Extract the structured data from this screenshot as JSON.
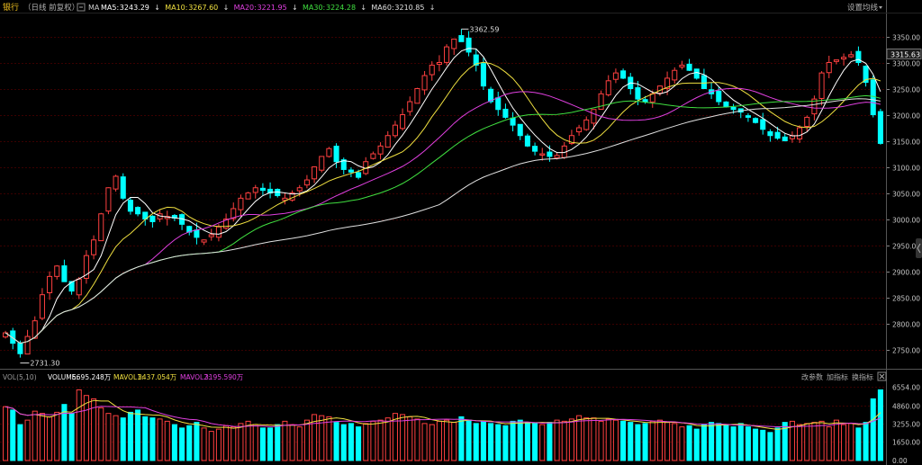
{
  "header": {
    "title": "银行",
    "period": "（日线 前复权）",
    "collapse_icon": "collapse-icon",
    "ma_prefix": "MA",
    "ma_items": [
      {
        "label": "MA5:",
        "value": "3243.29",
        "color": "#ffffff"
      },
      {
        "label": "MA10:",
        "value": "3267.60",
        "color": "#f0e040"
      },
      {
        "label": "MA20:",
        "value": "3221.95",
        "color": "#e040e0"
      },
      {
        "label": "MA30:",
        "value": "3224.28",
        "color": "#40e040"
      },
      {
        "label": "MA60:",
        "value": "3210.85",
        "color": "#e0e0e0"
      }
    ],
    "down_arrow": "↓",
    "settings_label": "设置均线",
    "settings_icon": "dropdown-icon"
  },
  "annotations": {
    "high": "3362.59",
    "low": "2731.30",
    "last_price": "3315.63"
  },
  "volume_header": {
    "title": "VOL(5,10)",
    "volume_label": "VOLUME:",
    "volume_value": "5695.248万",
    "mavol1_label": "MAVOL1:",
    "mavol1_value": "3437.054万",
    "mavol2_label": "MAVOL2:",
    "mavol2_value": "3195.590万",
    "buttons": [
      "改参数",
      "加指标",
      "换指标"
    ],
    "close_icon": "close-icon"
  },
  "colors": {
    "up": "#ff4040",
    "down": "#00ffff",
    "grid": "#3a0000",
    "axis_text": "#c8c8c8",
    "ma5": "#ffffff",
    "ma10": "#f0e040",
    "ma20": "#e040e0",
    "ma30": "#40e040",
    "ma60": "#e0e0e0",
    "vol_ma1": "#f0e040",
    "vol_ma2": "#e040e0"
  },
  "chart_data": {
    "type": "candlestick",
    "price_axis": {
      "ticks": [
        "3350.00",
        "3300.00",
        "3250.00",
        "3200.00",
        "3150.00",
        "3100.00",
        "3050.00",
        "3000.00",
        "2950.00",
        "2900.00",
        "2850.00",
        "2800.00",
        "2750.00"
      ],
      "range": [
        2720,
        3375
      ]
    },
    "volume_axis": {
      "ticks": [
        "6554.00",
        "4860.00",
        "3255.00",
        "1650.00",
        "0.00"
      ],
      "range": [
        0,
        6900
      ]
    },
    "closes": [
      2782,
      2762,
      2742,
      2775,
      2805,
      2855,
      2890,
      2910,
      2880,
      2862,
      2885,
      2930,
      2960,
      3010,
      3060,
      3082,
      3040,
      3015,
      3010,
      3000,
      2995,
      3010,
      3005,
      3002,
      2990,
      2975,
      2965,
      2960,
      2970,
      2985,
      3000,
      3020,
      3040,
      3050,
      3060,
      3055,
      3050,
      3045,
      3040,
      3050,
      3060,
      3075,
      3100,
      3120,
      3135,
      3110,
      3095,
      3090,
      3080,
      3110,
      3125,
      3140,
      3160,
      3180,
      3200,
      3225,
      3250,
      3275,
      3295,
      3300,
      3330,
      3345,
      3340,
      3320,
      3295,
      3255,
      3225,
      3210,
      3195,
      3180,
      3160,
      3140,
      3130,
      3125,
      3120,
      3122,
      3140,
      3160,
      3175,
      3190,
      3210,
      3240,
      3265,
      3280,
      3270,
      3250,
      3230,
      3225,
      3240,
      3255,
      3270,
      3285,
      3295,
      3285,
      3270,
      3250,
      3240,
      3225,
      3215,
      3210,
      3205,
      3195,
      3185,
      3172,
      3160,
      3155,
      3150,
      3160,
      3175,
      3195,
      3230,
      3280,
      3300,
      3305,
      3310,
      3315,
      3300,
      3262,
      3200,
      3145
    ],
    "open_close_jitter": 15,
    "volumes": [
      4800,
      4500,
      3200,
      3600,
      4400,
      4200,
      3900,
      4300,
      5000,
      4200,
      6300,
      5800,
      5500,
      4700,
      4200,
      4000,
      3800,
      4300,
      4500,
      3900,
      3800,
      3700,
      3500,
      3200,
      2900,
      3100,
      3400,
      2900,
      2600,
      2800,
      3100,
      3000,
      3300,
      3500,
      3200,
      2900,
      2900,
      3200,
      3500,
      3200,
      3000,
      3600,
      4100,
      4000,
      3900,
      3400,
      3200,
      3300,
      3000,
      3300,
      3500,
      3600,
      3800,
      4200,
      4100,
      3900,
      3700,
      3300,
      3200,
      3500,
      3600,
      3400,
      3900,
      3600,
      3300,
      3500,
      3300,
      3200,
      3100,
      3500,
      3600,
      3400,
      3300,
      3200,
      3400,
      3600,
      3500,
      3700,
      4000,
      3800,
      3800,
      3500,
      3700,
      3600,
      3500,
      3400,
      3200,
      3300,
      3500,
      3600,
      3400,
      3300,
      3000,
      3100,
      2800,
      3200,
      3400,
      3300,
      3200,
      3000,
      3300,
      3000,
      2800,
      2700,
      2500,
      2900,
      3400,
      3500,
      3200,
      3300,
      3400,
      3500,
      3000,
      3600,
      3200,
      3300,
      2900,
      3400,
      5500,
      6300
    ]
  }
}
